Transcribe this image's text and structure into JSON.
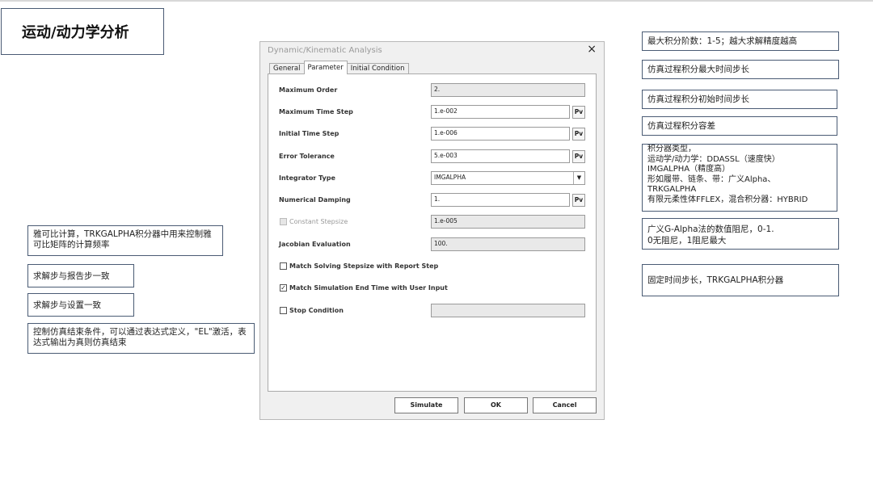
{
  "slide": {
    "title": "运动/动力学分析"
  },
  "dialog": {
    "title": "Dynamic/Kinematic Analysis",
    "close_icon": "×",
    "tabs": [
      {
        "label": "General",
        "active": false
      },
      {
        "label": "Parameter",
        "active": true
      },
      {
        "label": "Initial Condition",
        "active": false
      }
    ],
    "fields": {
      "max_order": {
        "label": "Maximum Order",
        "value": "2."
      },
      "max_time_step": {
        "label": "Maximum Time Step",
        "value": "1.e-002"
      },
      "initial_time_step": {
        "label": "Initial Time Step",
        "value": "1.e-006"
      },
      "error_tolerance": {
        "label": "Error Tolerance",
        "value": "5.e-003"
      },
      "integrator_type": {
        "label": "Integrator Type",
        "value": "IMGALPHA"
      },
      "numerical_damping": {
        "label": "Numerical Damping",
        "value": "1."
      },
      "constant_stepsize": {
        "label": "Constant Stepsize",
        "value": "1.e-005"
      },
      "jacobian_evaluation": {
        "label": "Jacobian Evaluation",
        "value": "100."
      }
    },
    "pv_label": "Pv",
    "checkboxes": {
      "match_stepsize": {
        "label": "Match Solving Stepsize with Report Step",
        "checked": false
      },
      "match_end_time": {
        "label": "Match Simulation End Time with User Input",
        "checked": true
      },
      "stop_condition": {
        "label": "Stop Condition",
        "checked": false
      }
    },
    "check_mark": "✓",
    "dropdown_icon": "▼",
    "buttons": {
      "simulate": "Simulate",
      "ok": "OK",
      "cancel": "Cancel"
    }
  },
  "notes_right": {
    "max_order": "最大积分阶数：1-5；越大求解精度越高",
    "max_step": "仿真过程积分最大时间步长",
    "init_step": "仿真过程积分初始时间步长",
    "tolerance": "仿真过程积分容差",
    "integrator": [
      "积分器类型，",
      "运动学/动力学：DDASSL（速度快）",
      "IMGALPHA（精度高）",
      "形如履带、链条、带：广义Alpha、",
      "TRKGALPHA",
      "有限元柔性体FFLEX，混合积分器：HYBRID"
    ],
    "damping": [
      "广义G-Alpha法的数值阻尼，0-1.",
      "0无阻尼，1阻尼最大"
    ],
    "fixed_step": "固定时间步长，TRKGALPHA积分器"
  },
  "notes_left": {
    "jacobian": "雅可比计算，TRKGALPHA积分器中用来控制雅可比矩阵的计算频率",
    "stepsize_report": "求解步与报告步一致",
    "stepsize_setting": "求解步与设置一致",
    "stop_condition": "控制仿真结束条件，可以通过表达式定义，\"EL\"激活，表达式输出为真则仿真结束"
  }
}
